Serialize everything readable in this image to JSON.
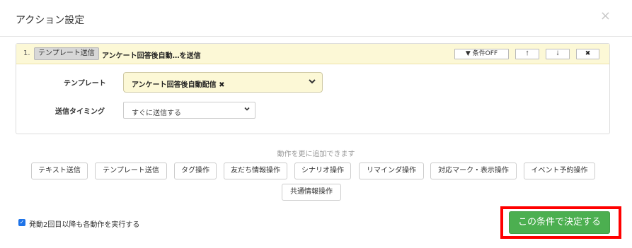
{
  "modal": {
    "title": "アクション設定",
    "close_glyph": "×"
  },
  "action": {
    "number": "1.",
    "type_badge": "テンプレート送信",
    "title": "アンケート回答後自動…を送信",
    "buttons": {
      "condition": "▼ 条件OFF",
      "up": "🠕",
      "down": "🠗",
      "delete": "✖"
    },
    "template": {
      "label": "テンプレート",
      "value": "アンケート回答後自動配信 ✖",
      "chevron": "❯"
    },
    "timing": {
      "label": "送信タイミング",
      "value": "すぐに送信する",
      "chevron": "⌄"
    }
  },
  "add_hint": "動作を更に追加できます",
  "operations": [
    "テキスト送信",
    "テンプレート送信",
    "タグ操作",
    "友だち情報操作",
    "シナリオ操作",
    "リマインダ操作",
    "対応マーク・表示操作",
    "イベント予約操作",
    "共通情報操作"
  ],
  "repeat_option": {
    "checked": true,
    "label": "発動2回目以降も各動作を実行する"
  },
  "confirm_button": "この条件で決定する",
  "colors": {
    "accent_green": "#4caf50",
    "highlight_red": "#ff0000",
    "header_yellow": "#fcf8d6",
    "checkbox_blue": "#1e73e8"
  }
}
